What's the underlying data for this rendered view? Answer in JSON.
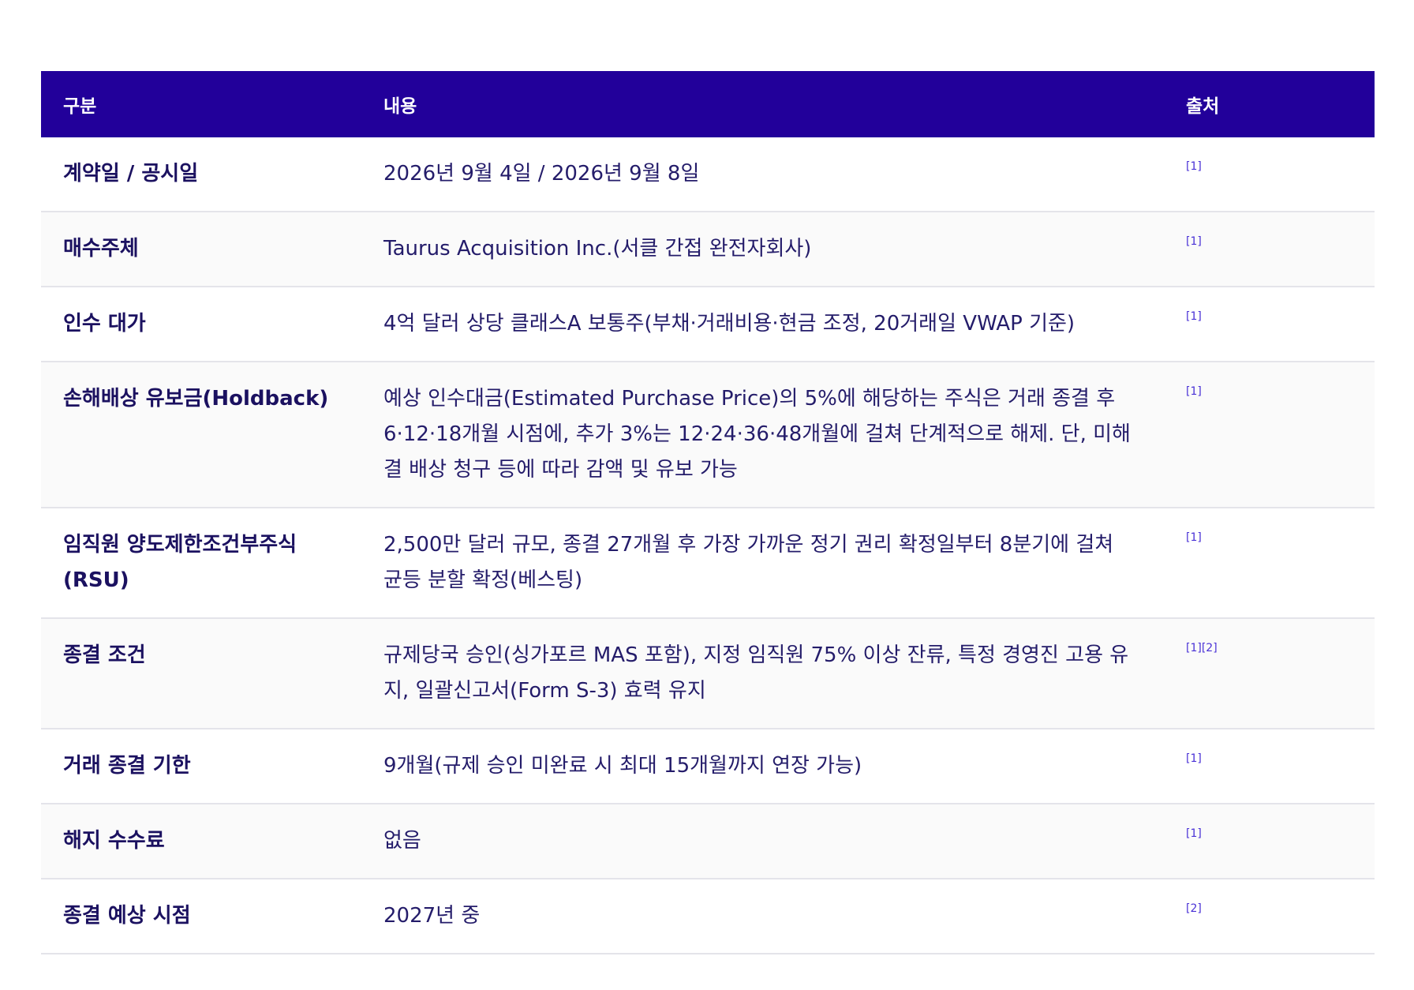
{
  "table": {
    "headers": {
      "category": "구분",
      "content": "내용",
      "source": "출처"
    },
    "rows": [
      {
        "category": "계약일 / 공시일",
        "content": "2026년 9월 4일 / 2026년 9월 8일",
        "source": "[1]"
      },
      {
        "category": "매수주체",
        "content": "Taurus Acquisition Inc.(서클 간접 완전자회사)",
        "source": "[1]"
      },
      {
        "category": "인수 대가",
        "content": "4억 달러 상당 클래스A 보통주(부채·거래비용·현금 조정, 20거래일 VWAP 기준)",
        "source": "[1]"
      },
      {
        "category": "손해배상 유보금(Holdback)",
        "content": "예상 인수대금(Estimated Purchase Price)의 5%에 해당하는 주식은 거래 종결 후 6·12·18개월 시점에, 추가 3%는 12·24·36·48개월에 걸쳐 단계적으로 해제. 단, 미해결 배상 청구 등에 따라 감액 및 유보 가능",
        "source": "[1]"
      },
      {
        "category": "임직원 양도제한조건부주식(RSU)",
        "content": "2,500만 달러 규모, 종결 27개월 후 가장 가까운 정기 권리 확정일부터 8분기에 걸쳐 균등 분할 확정(베스팅)",
        "source": "[1]"
      },
      {
        "category": "종결 조건",
        "content": "규제당국 승인(싱가포르 MAS 포함), 지정 임직원 75% 이상 잔류, 특정 경영진 고용 유지, 일괄신고서(Form S-3) 효력 유지",
        "source": "[1][2]"
      },
      {
        "category": "거래 종결 기한",
        "content": "9개월(규제 승인 미완료 시 최대 15개월까지 연장 가능)",
        "source": "[1]"
      },
      {
        "category": "해지 수수료",
        "content": "없음",
        "source": "[1]"
      },
      {
        "category": "종결 예상 시점",
        "content": "2027년 중",
        "source": "[2]"
      }
    ]
  }
}
